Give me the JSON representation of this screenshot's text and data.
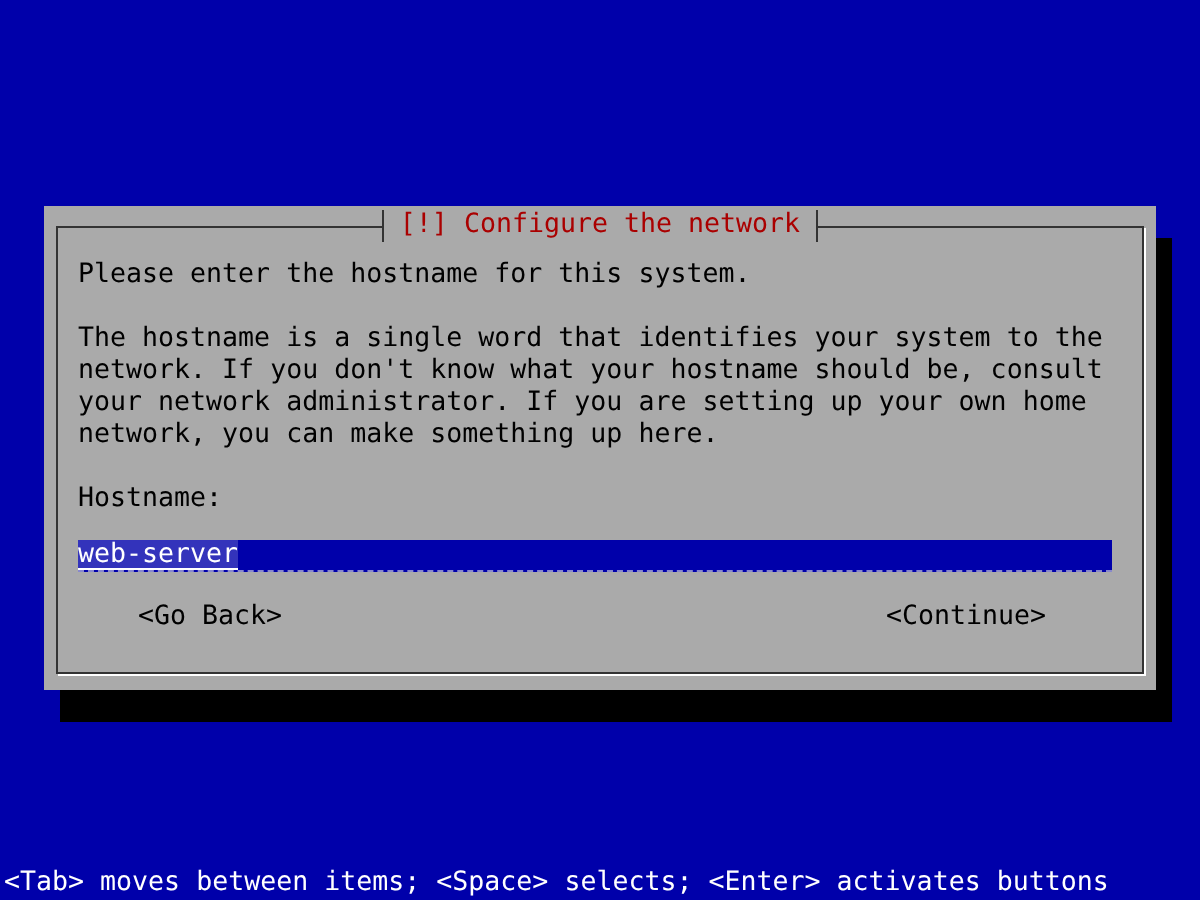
{
  "dialog": {
    "title": "[!] Configure the network",
    "prompt": "Please enter the hostname for this system.",
    "description": "The hostname is a single word that identifies your system to the network. If you don't know what your hostname should be, consult your network administrator. If you are setting up your own home network, you can make something up here.",
    "field": {
      "label": "Hostname:",
      "value": "web-server"
    },
    "buttons": [
      {
        "label": "<Go Back>"
      },
      {
        "label": "<Continue>"
      }
    ]
  },
  "help_line": "<Tab> moves between items; <Space> selects; <Enter> activates buttons"
}
